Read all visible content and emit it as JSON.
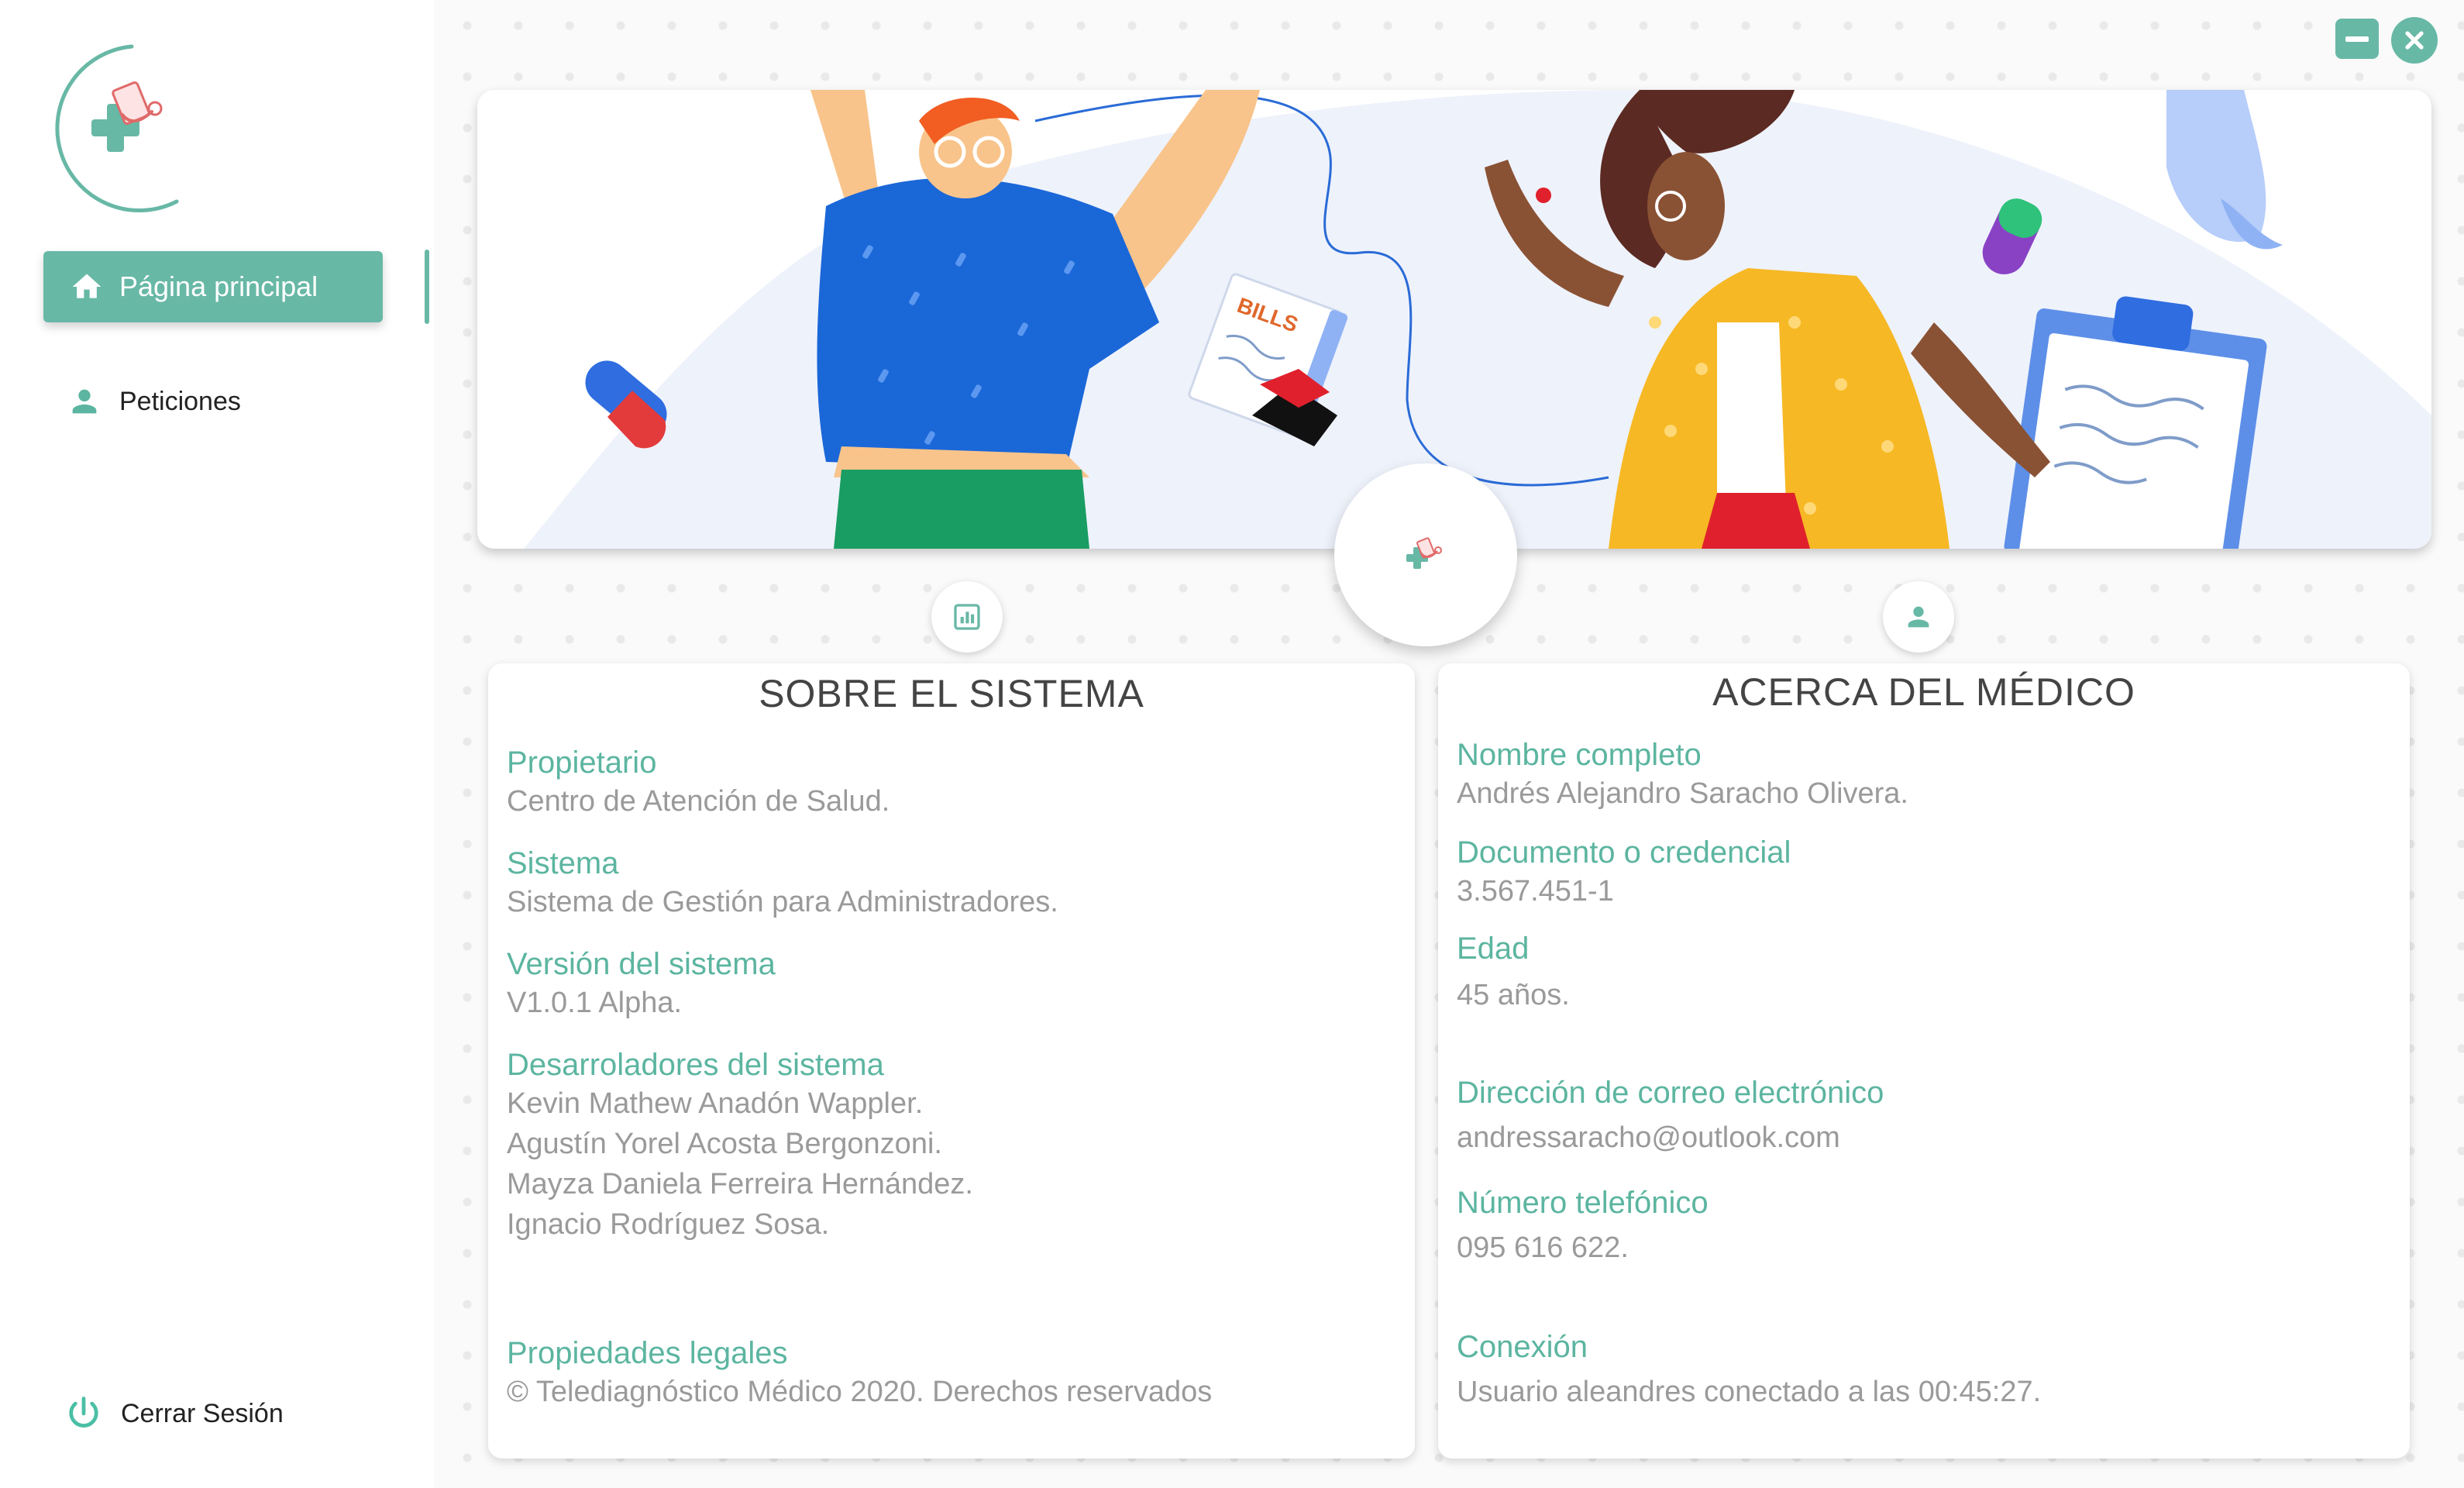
{
  "sidebar": {
    "nav_active_label": "Página principal",
    "nav_requests_label": "Peticiones",
    "logout_label": "Cerrar Sesión"
  },
  "window_controls": {
    "minimize_icon": "minimize-icon",
    "close_icon": "close-icon"
  },
  "about_system": {
    "title": "SOBRE EL SISTEMA",
    "owner_label": "Propietario",
    "owner_value": "Centro de Atención de Salud.",
    "system_label": "Sistema",
    "system_value": "Sistema de Gestión para Administradores.",
    "version_label": "Versión del sistema",
    "version_value": "V1.0.1 Alpha.",
    "devs_label": "Desarroladores del sistema",
    "devs": [
      "Kevin Mathew Anadón Wappler.",
      "Agustín Yorel Acosta Bergonzoni.",
      "Mayza Daniela Ferreira Hernández.",
      "Ignacio Rodríguez Sosa."
    ],
    "legal_label": "Propiedades legales",
    "legal_value": "© Telediagnóstico Médico 2020. Derechos reservados"
  },
  "about_doctor": {
    "title": "ACERCA DEL MÉDICO",
    "name_label": "Nombre completo",
    "name_value": "Andrés Alejandro Saracho Olivera.",
    "doc_label": "Documento o credencial",
    "doc_value": "3.567.451-1",
    "age_label": "Edad",
    "age_value": "45 años.",
    "email_label": "Dirección de correo electrónico",
    "email_value": "andressaracho@outlook.com",
    "phone_label": "Número telefónico",
    "phone_value": "095 616 622.",
    "connection_label": "Conexión",
    "connection_value": "Usuario aleandres conectado a las 00:45:27."
  },
  "banner": {
    "bills_text": "BILLS"
  },
  "colors": {
    "accent": "#68b8a6",
    "label_green": "#5cb5a0",
    "value_gray": "#9a9a9a",
    "title_gray": "#444444"
  }
}
